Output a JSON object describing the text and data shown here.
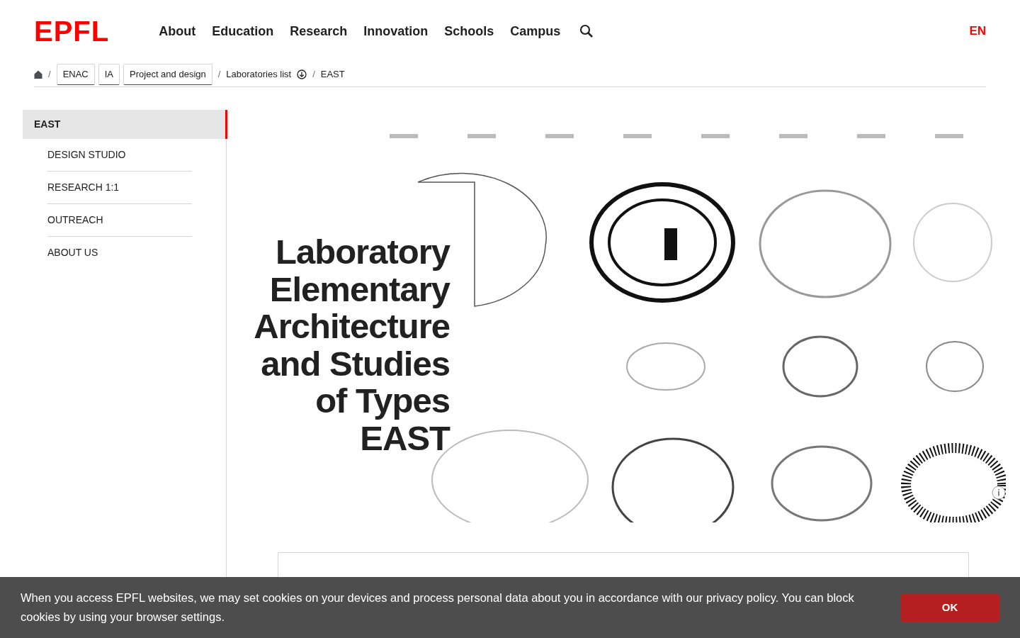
{
  "header": {
    "logo": "EPFL",
    "nav": [
      {
        "label": "About"
      },
      {
        "label": "Education"
      },
      {
        "label": "Research"
      },
      {
        "label": "Innovation"
      },
      {
        "label": "Schools"
      },
      {
        "label": "Campus"
      }
    ],
    "languages": [
      {
        "label": "EN",
        "selected": true
      }
    ]
  },
  "breadcrumb_separator": "/",
  "breadcrumb": [
    {
      "label": "ENAC",
      "kind": "tag"
    },
    {
      "label": "IA",
      "kind": "tag"
    },
    {
      "label": "Project and design",
      "kind": "tag"
    },
    {
      "label": "Laboratories list",
      "kind": "dropdown"
    },
    {
      "label": "EAST",
      "kind": "plain"
    }
  ],
  "sidebar": {
    "items": [
      {
        "label": "EAST",
        "selected": true,
        "children": [
          {
            "label": "DESIGN STUDIO",
            "selected": false
          },
          {
            "label": "RESEARCH 1:1",
            "selected": false
          },
          {
            "label": "OUTREACH",
            "selected": false
          },
          {
            "label": "ABOUT US",
            "selected": false
          }
        ]
      }
    ]
  },
  "hero": {
    "kind": "picture",
    "title_lines": [
      "Laboratory",
      "Elementary",
      "Architecture",
      "and Studies",
      "of Types",
      "EAST"
    ]
  },
  "cookie_banner": {
    "text_before": "When you access EPFL websites, we may set cookies on your devices and process personal data about you in accordance with our ",
    "link": "privacy policy",
    "text_after": ". You can block cookies by using your browser settings.",
    "button": "OK"
  }
}
